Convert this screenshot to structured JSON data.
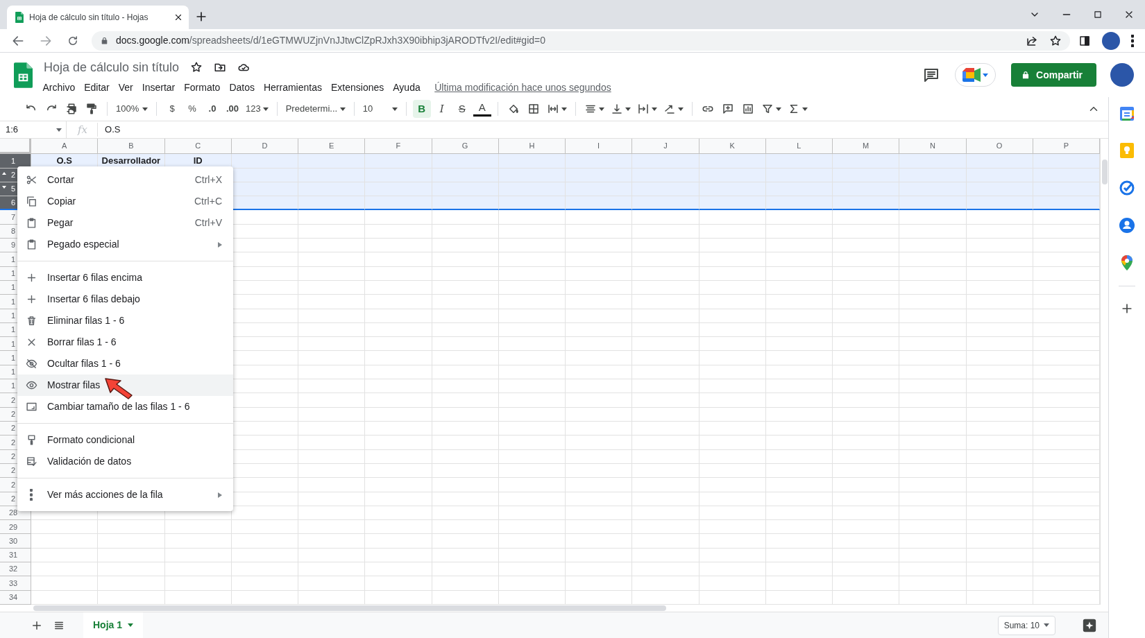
{
  "browser": {
    "tab": {
      "title": "Hoja de cálculo sin título - Hojas",
      "selected": true
    },
    "url": {
      "host": "docs.google.com",
      "path": "/spreadsheets/d/1eGTMWUZjnVnJJtwClZpRJxh3X90ibhip3jARODTfv2I/edit#gid=0"
    }
  },
  "doc": {
    "title": "Hoja de cálculo sin título",
    "menu": [
      "Archivo",
      "Editar",
      "Ver",
      "Insertar",
      "Formato",
      "Datos",
      "Herramientas",
      "Extensiones",
      "Ayuda"
    ],
    "last_edit": "Última modificación hace unos segundos",
    "share": "Compartir"
  },
  "toolbar": {
    "zoom": "100%",
    "currency": "$",
    "percent": "%",
    "decimals_less": ".0",
    "decimals_more": ".00",
    "number_format": "123",
    "font": "Predetermi...",
    "font_size": "10",
    "styles": [
      {
        "kind": "bold",
        "label": "B",
        "selected": true
      },
      {
        "kind": "italic",
        "label": "I",
        "selected": false
      },
      {
        "kind": "strike",
        "label": "S",
        "selected": false
      },
      {
        "kind": "color",
        "label": "A",
        "selected": false
      }
    ]
  },
  "formula_bar": {
    "cell": "1:6",
    "fx": "fx",
    "value": "O.S"
  },
  "sheet": {
    "columns": [
      "A",
      "B",
      "C",
      "D",
      "E",
      "F",
      "G",
      "H",
      "I",
      "J",
      "K",
      "L",
      "M",
      "N",
      "O",
      "P"
    ],
    "rows": [
      {
        "label": "1",
        "selected": true,
        "cells": [
          "O.S",
          "Desarrollador",
          "ID"
        ]
      },
      {
        "label": "2",
        "selected": true,
        "marker_up": true
      },
      {
        "label": "5",
        "selected": true,
        "marker_down": true
      },
      {
        "label": "6",
        "selected": true
      },
      {
        "label": "7",
        "selected": false
      },
      {
        "label": "8",
        "selected": false
      },
      {
        "label": "9",
        "selected": false
      },
      {
        "label": "1",
        "selected": false
      },
      {
        "label": "1",
        "selected": false
      },
      {
        "label": "1",
        "selected": false
      },
      {
        "label": "1",
        "selected": false
      },
      {
        "label": "1",
        "selected": false
      },
      {
        "label": "1",
        "selected": false
      },
      {
        "label": "1",
        "selected": false
      },
      {
        "label": "1",
        "selected": false
      },
      {
        "label": "1",
        "selected": false
      },
      {
        "label": "1",
        "selected": false
      },
      {
        "label": "2",
        "selected": false
      },
      {
        "label": "2",
        "selected": false
      },
      {
        "label": "2",
        "selected": false
      },
      {
        "label": "2",
        "selected": false
      },
      {
        "label": "2",
        "selected": false
      },
      {
        "label": "2",
        "selected": false
      },
      {
        "label": "2",
        "selected": false
      },
      {
        "label": "2",
        "selected": false
      },
      {
        "label": "28",
        "selected": false
      },
      {
        "label": "29",
        "selected": false
      },
      {
        "label": "30",
        "selected": false
      },
      {
        "label": "31",
        "selected": false
      },
      {
        "label": "32",
        "selected": false
      },
      {
        "label": "33",
        "selected": false
      },
      {
        "label": "34",
        "selected": false
      }
    ]
  },
  "context_menu": {
    "groups": [
      [
        {
          "label": "Cortar",
          "shortcut": "Ctrl+X",
          "selected": false
        },
        {
          "label": "Copiar",
          "shortcut": "Ctrl+C",
          "selected": false
        },
        {
          "label": "Pegar",
          "shortcut": "Ctrl+V",
          "selected": false
        },
        {
          "label": "Pegado especial",
          "submenu": true,
          "selected": false
        }
      ],
      [
        {
          "label": "Insertar 6 filas encima",
          "selected": false
        },
        {
          "label": "Insertar 6 filas debajo",
          "selected": false
        },
        {
          "label": "Eliminar filas 1 - 6",
          "selected": false
        },
        {
          "label": "Borrar filas 1 - 6",
          "selected": false
        },
        {
          "label": "Ocultar filas 1 - 6",
          "selected": false
        },
        {
          "label": "Mostrar filas",
          "selected": true
        },
        {
          "label": "Cambiar tamaño de las filas 1 - 6",
          "selected": false
        }
      ],
      [
        {
          "label": "Formato condicional",
          "selected": false
        },
        {
          "label": "Validación de datos",
          "selected": false
        }
      ],
      [
        {
          "label": "Ver más acciones de la fila",
          "submenu": true,
          "selected": false
        }
      ]
    ]
  },
  "sheet_tabs": [
    {
      "label": "Hoja 1",
      "selected": true
    }
  ],
  "sum": "Suma: 10"
}
